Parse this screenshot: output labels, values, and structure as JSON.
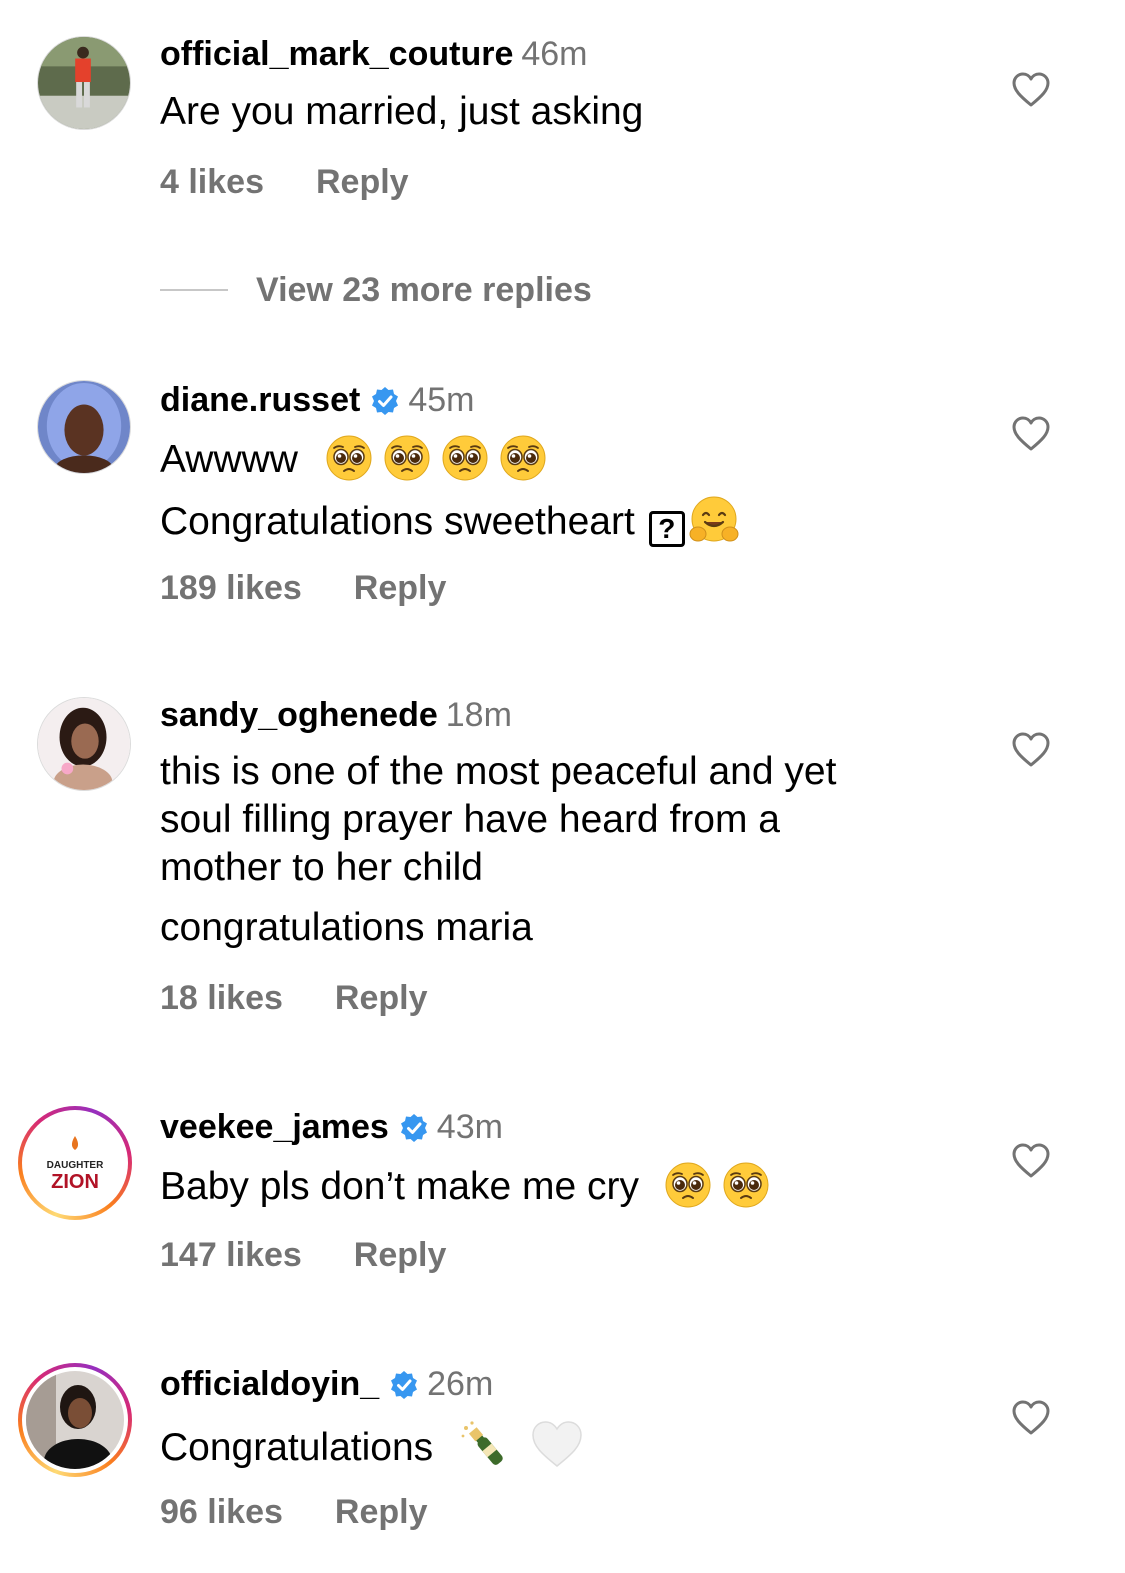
{
  "colors": {
    "text": "#000000",
    "secondary": "#737373",
    "verified": "#3797f0",
    "ring_start": "#feda75",
    "ring_end": "#d62976"
  },
  "comments": [
    {
      "username": "official_mark_couture",
      "time": "46m",
      "verified": false,
      "lines": [
        "Are you married, just asking"
      ],
      "likes": "4 likes",
      "reply": "Reply",
      "view_more": "View 23 more replies"
    },
    {
      "username": "diane.russet",
      "time": "45m",
      "verified": true,
      "lines": [
        "Awwww",
        "Congratulations sweetheart"
      ],
      "emoji": [
        "pleading-face",
        "pleading-face",
        "pleading-face",
        "pleading-face",
        "hugging-face"
      ],
      "likes": "189 likes",
      "reply": "Reply"
    },
    {
      "username": "sandy_oghenede",
      "time": "18m",
      "verified": false,
      "lines": [
        "this is one of the most peaceful and yet",
        "soul filling prayer have heard from a",
        "mother to her child",
        "congratulations maria"
      ],
      "likes": "18 likes",
      "reply": "Reply"
    },
    {
      "username": "veekee_james",
      "time": "43m",
      "verified": true,
      "avatar_logo": {
        "line1": "DAUGHTER",
        "line2": "ZION"
      },
      "lines": [
        "Baby pls don’t make me cry"
      ],
      "emoji": [
        "pleading-face",
        "pleading-face"
      ],
      "likes": "147 likes",
      "reply": "Reply"
    },
    {
      "username": "officialdoyin_",
      "time": "26m",
      "verified": true,
      "lines": [
        "Congratulations"
      ],
      "emoji": [
        "champagne",
        "white-heart"
      ],
      "likes": "96 likes",
      "reply": "Reply"
    }
  ]
}
